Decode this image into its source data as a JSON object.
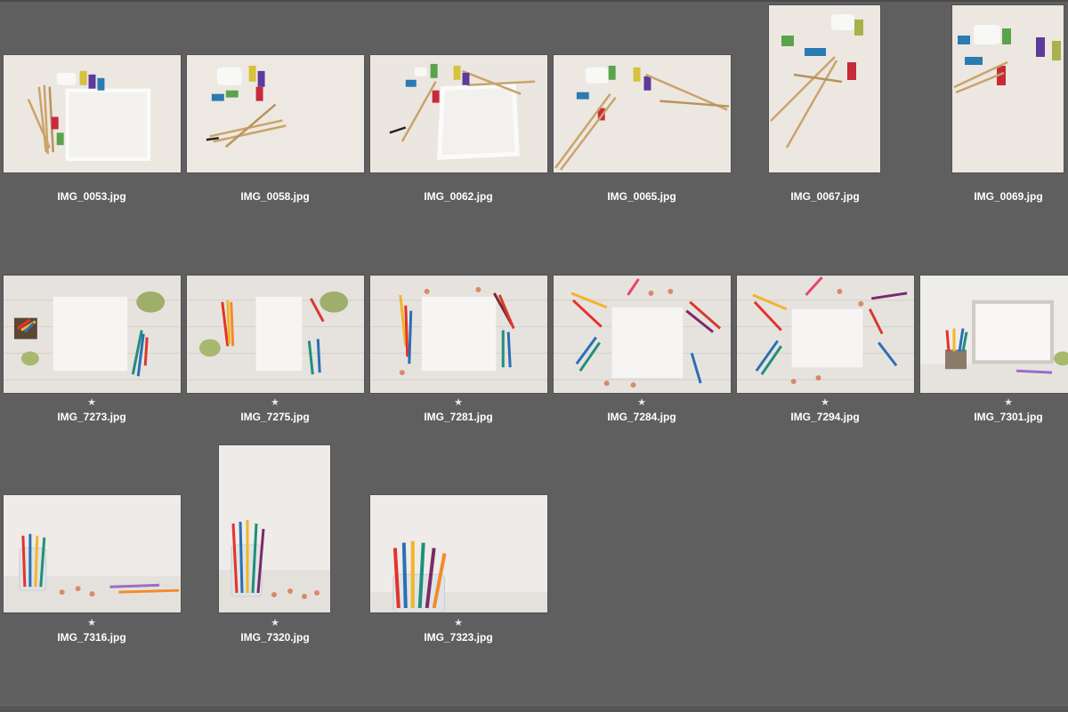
{
  "browser": {
    "rating_glyph": "★",
    "rows": [
      [
        {
          "filename": "IMG_0053.jpg",
          "rated": false,
          "orientation": "landscape",
          "scene": "paint"
        },
        {
          "filename": "IMG_0058.jpg",
          "rated": false,
          "orientation": "landscape",
          "scene": "paint"
        },
        {
          "filename": "IMG_0062.jpg",
          "rated": false,
          "orientation": "landscape",
          "scene": "paint"
        },
        {
          "filename": "IMG_0065.jpg",
          "rated": false,
          "orientation": "landscape",
          "scene": "paint"
        },
        {
          "filename": "IMG_0067.jpg",
          "rated": false,
          "orientation": "portrait",
          "scene": "paint"
        },
        {
          "filename": "IMG_0069.jpg",
          "rated": false,
          "orientation": "portrait",
          "scene": "paint"
        }
      ],
      [
        {
          "filename": "IMG_7273.jpg",
          "rated": true,
          "orientation": "landscape",
          "scene": "pencils-board"
        },
        {
          "filename": "IMG_7275.jpg",
          "rated": true,
          "orientation": "landscape",
          "scene": "pencils-board"
        },
        {
          "filename": "IMG_7281.jpg",
          "rated": true,
          "orientation": "landscape",
          "scene": "pencils-board"
        },
        {
          "filename": "IMG_7284.jpg",
          "rated": true,
          "orientation": "landscape",
          "scene": "pencils-board"
        },
        {
          "filename": "IMG_7294.jpg",
          "rated": true,
          "orientation": "landscape",
          "scene": "pencils-board"
        },
        {
          "filename": "IMG_7301.jpg",
          "rated": true,
          "orientation": "landscape",
          "scene": "frame-table"
        }
      ],
      [
        {
          "filename": "IMG_7316.jpg",
          "rated": true,
          "orientation": "landscape",
          "scene": "pencil-jar"
        },
        {
          "filename": "IMG_7320.jpg",
          "rated": true,
          "orientation": "portrait",
          "scene": "pencil-jar"
        },
        {
          "filename": "IMG_7323.jpg",
          "rated": true,
          "orientation": "landscape",
          "scene": "pencil-jar"
        }
      ]
    ]
  },
  "colors": {
    "background": "#5f5f5f",
    "label": "#ffffff",
    "star": "#e8e8e8"
  }
}
